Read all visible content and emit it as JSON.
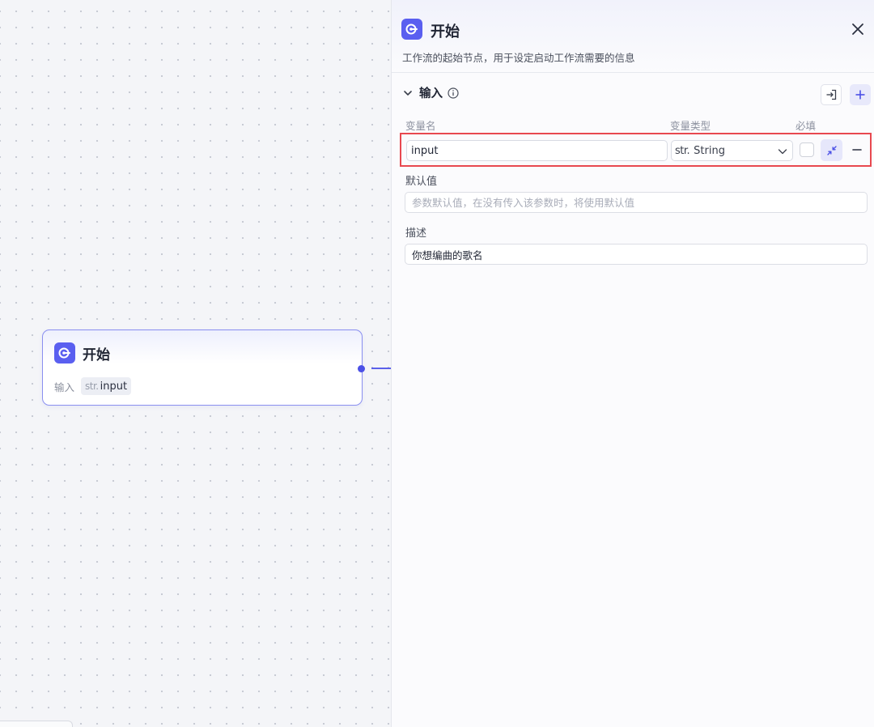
{
  "node": {
    "title": "开始",
    "input_label": "输入",
    "var_type_prefix": "str.",
    "var_name": "input"
  },
  "panel": {
    "title": "开始",
    "description": "工作流的起始节点，用于设定启动工作流需要的信息",
    "section_title": "输入",
    "columns": {
      "name": "变量名",
      "type": "变量类型",
      "required": "必填"
    },
    "variable": {
      "name": "input",
      "type_prefix": "str.",
      "type": "String",
      "required": false
    },
    "default_value": {
      "label": "默认值",
      "placeholder": "参数默认值，在没有传入该参数时，将使用默认值",
      "value": ""
    },
    "description_field": {
      "label": "描述",
      "value": "你想编曲的歌名"
    }
  },
  "colors": {
    "accent": "#5a5ff0",
    "highlight_border": "#e8484f"
  },
  "icons": [
    "start-logo-icon",
    "close-icon",
    "chevron-down-icon",
    "info-icon",
    "import-icon",
    "plus-icon",
    "collapse-icon",
    "minus-icon"
  ]
}
